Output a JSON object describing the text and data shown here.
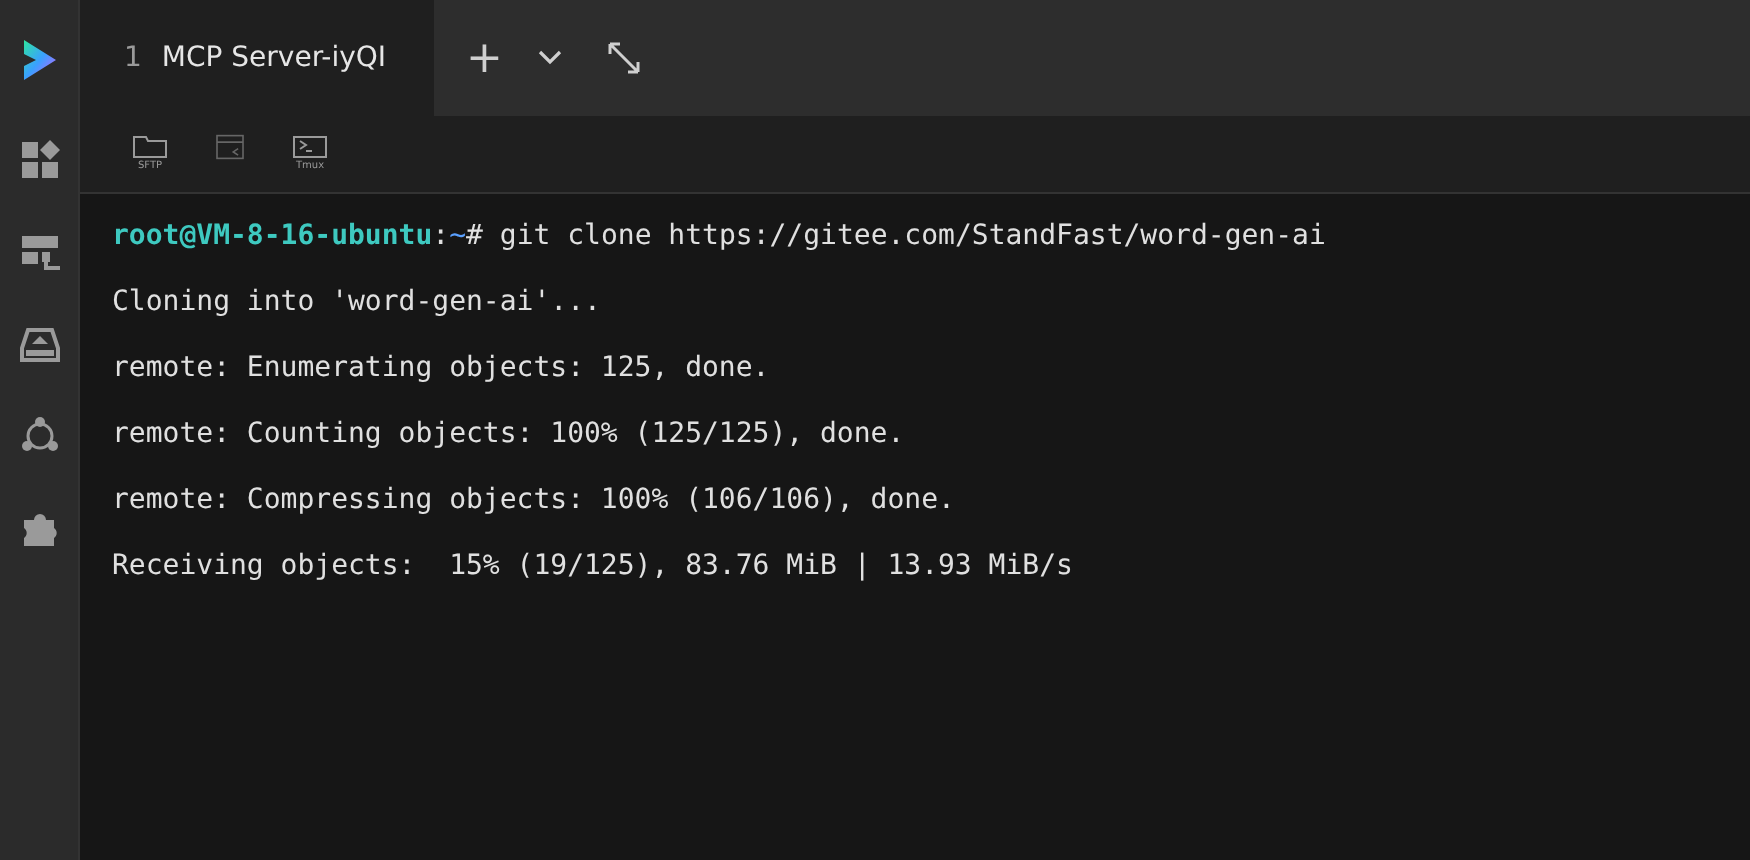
{
  "tabs": [
    {
      "number": "1",
      "label": "MCP Server-iyQI",
      "selected": true
    }
  ],
  "tab_actions": [
    "+"
  ],
  "toolbar": [
    {
      "kind": "sftp",
      "label": "SFTP"
    },
    {
      "kind": "window"
    },
    {
      "kind": "tmux",
      "label": "Tmux"
    }
  ],
  "sidebar": {
    "items": [
      {
        "kind": "apps"
      },
      {
        "kind": "servers"
      },
      {
        "kind": "drive"
      },
      {
        "kind": "network"
      },
      {
        "kind": "plugin"
      }
    ]
  },
  "terminal": {
    "lines": [
      {
        "kind": "prompt",
        "user": "root@VM-8-16-ubuntu",
        "separator": ":",
        "path": "~",
        "command": "# git clone https://gitee.com/StandFast/word-gen-ai"
      },
      {
        "kind": "output",
        "text": "Cloning into 'word-gen-ai'..."
      },
      {
        "kind": "output",
        "text": "remote: Enumerating objects: 125, done."
      },
      {
        "kind": "output",
        "text": "remote: Counting objects: 100% (125/125), done."
      },
      {
        "kind": "output",
        "text": "remote: Compressing objects: 100% (106/106), done."
      },
      {
        "kind": "output",
        "text": "Receiving objects:  15% (19/125), 83.76 MiB | 13.93 MiB/s"
      }
    ]
  }
}
